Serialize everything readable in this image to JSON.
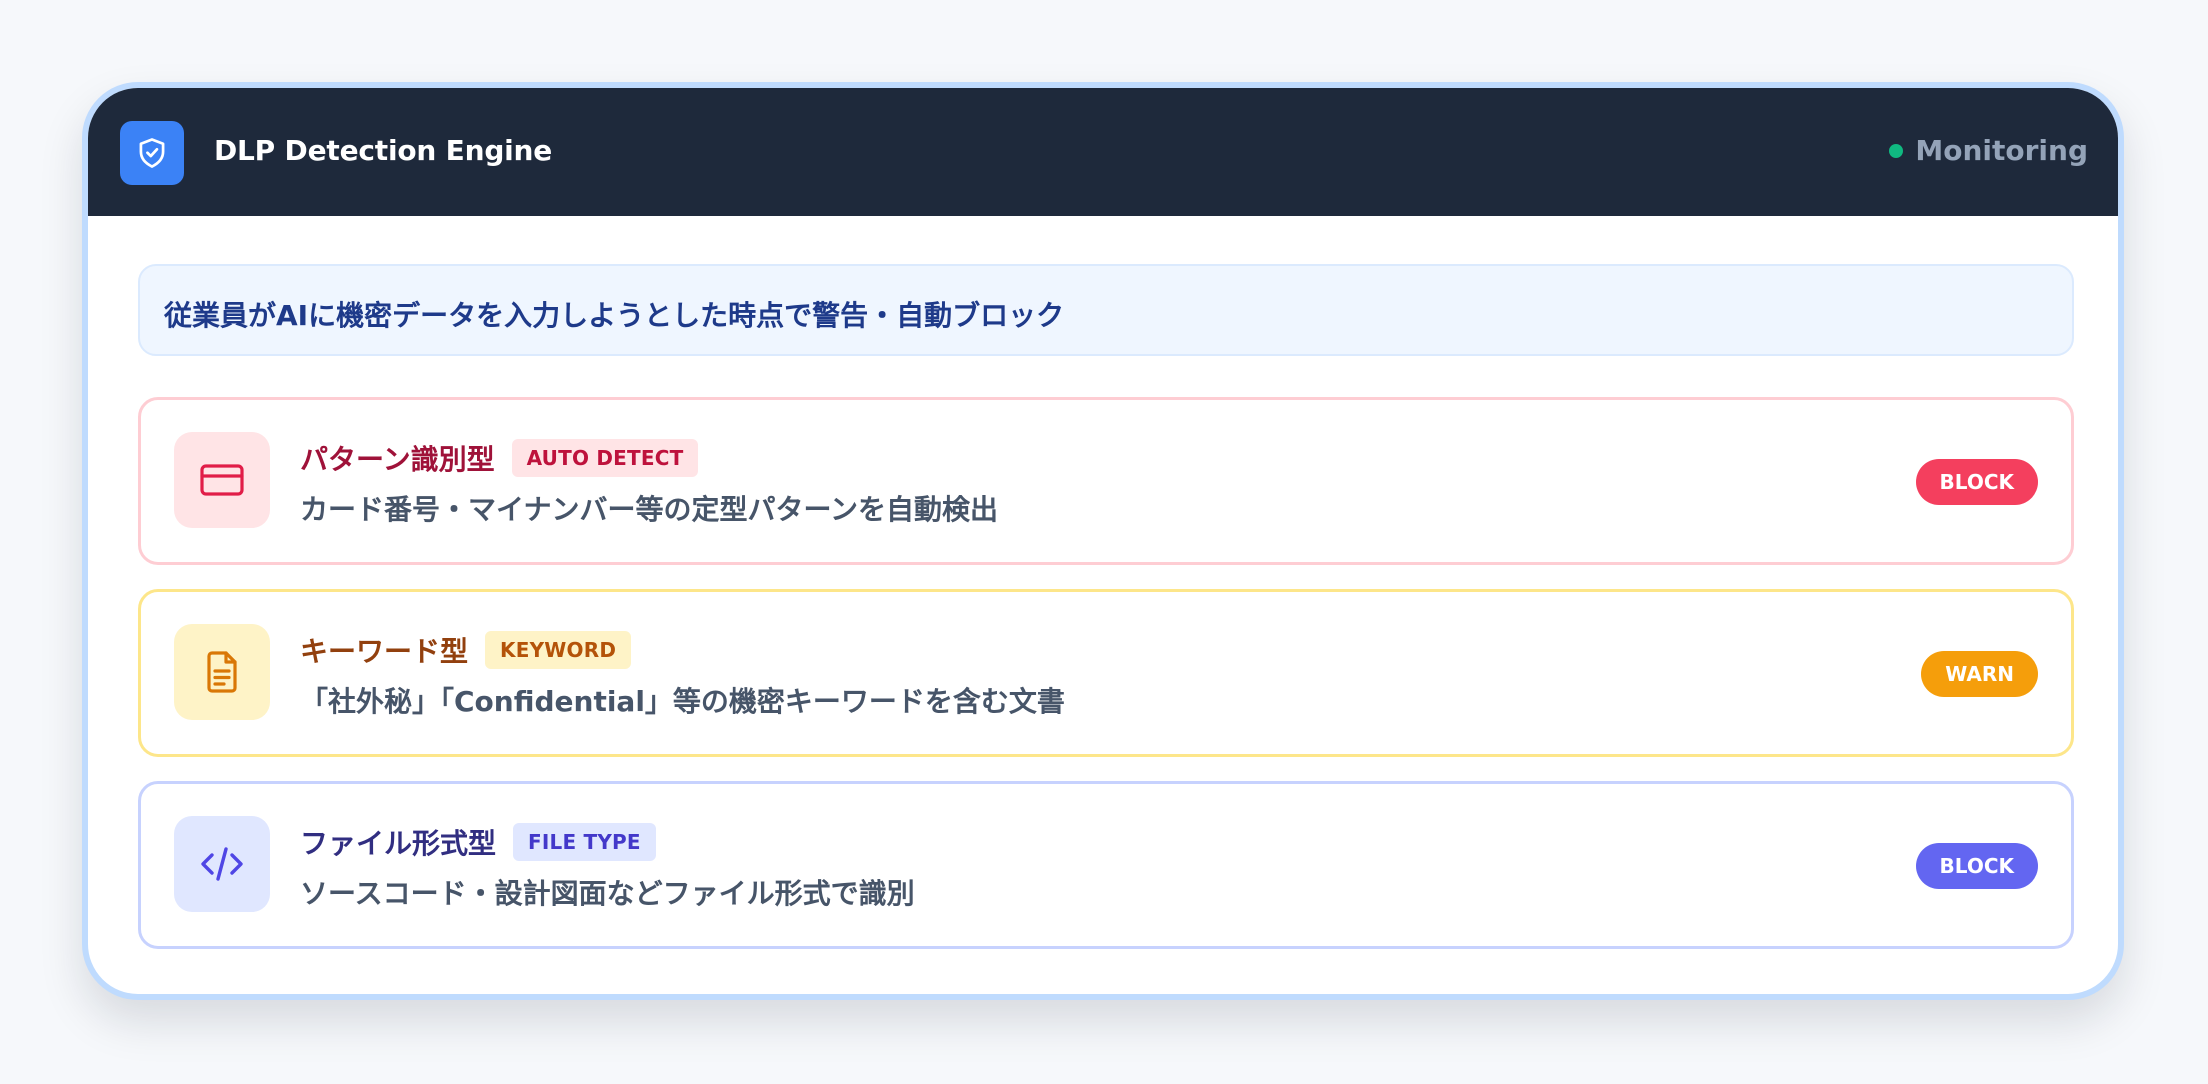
{
  "header": {
    "title": "DLP Detection Engine",
    "logo_icon": "shield-check-icon",
    "status_label": "Monitoring",
    "status_color": "#10b981"
  },
  "banner": {
    "text": "従業員がAIに機密データを入力しようとした時点で警告・自動ブロック"
  },
  "rules": [
    {
      "icon": "credit-card-icon",
      "title": "パターン識別型",
      "tag": "AUTO DETECT",
      "description": "カード番号・マイナンバー等の定型パターンを自動検出",
      "action": "BLOCK",
      "accent": "#f43f5e"
    },
    {
      "icon": "document-text-icon",
      "title": "キーワード型",
      "tag": "KEYWORD",
      "description": "「社外秘」「Confidential」等の機密キーワードを含む文書",
      "action": "WARN",
      "accent": "#f59e0b"
    },
    {
      "icon": "code-icon",
      "title": "ファイル形式型",
      "tag": "FILE TYPE",
      "description": "ソースコード・設計図面などファイル形式で識別",
      "action": "BLOCK",
      "accent": "#6366f1"
    }
  ]
}
